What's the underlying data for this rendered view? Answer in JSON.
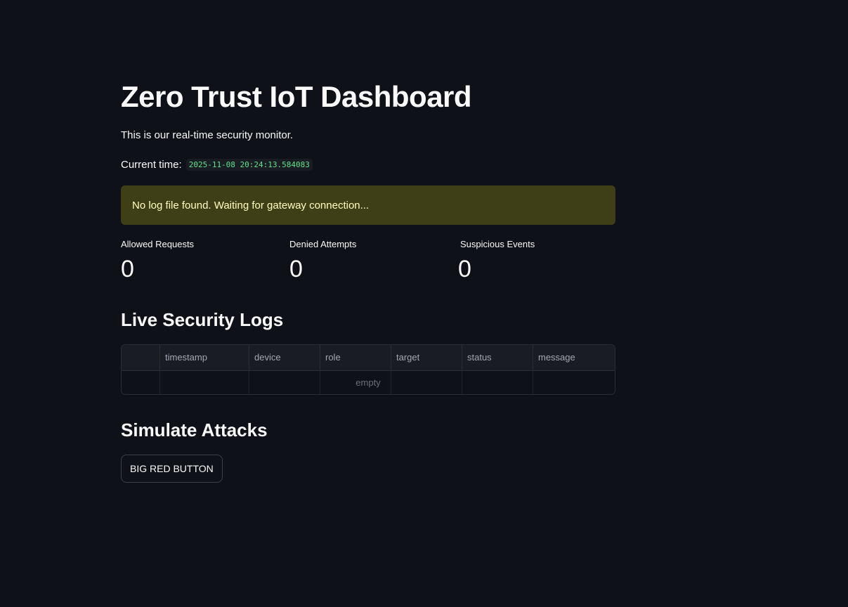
{
  "page": {
    "title": "Zero Trust IoT Dashboard",
    "intro": "This is our real-time security monitor.",
    "time_label": "Current time:",
    "time_value": "2025-11-08 20:24:13.584083"
  },
  "alert": {
    "message": "No log file found. Waiting for gateway connection..."
  },
  "metrics": [
    {
      "label": "Allowed Requests",
      "value": "0"
    },
    {
      "label": "Denied Attempts",
      "value": "0"
    },
    {
      "label": "Suspicious Events",
      "value": "0"
    }
  ],
  "logs": {
    "heading": "Live Security Logs",
    "columns": [
      "",
      "timestamp",
      "device",
      "role",
      "target",
      "status",
      "message"
    ],
    "empty_text": "empty"
  },
  "simulate": {
    "heading": "Simulate Attacks",
    "button_label": "BIG RED BUTTON"
  },
  "colors": {
    "background": "#0e1117",
    "warning_bg": "#3e3f16",
    "warning_text": "#ffffc2",
    "code_text": "#5ce488"
  }
}
